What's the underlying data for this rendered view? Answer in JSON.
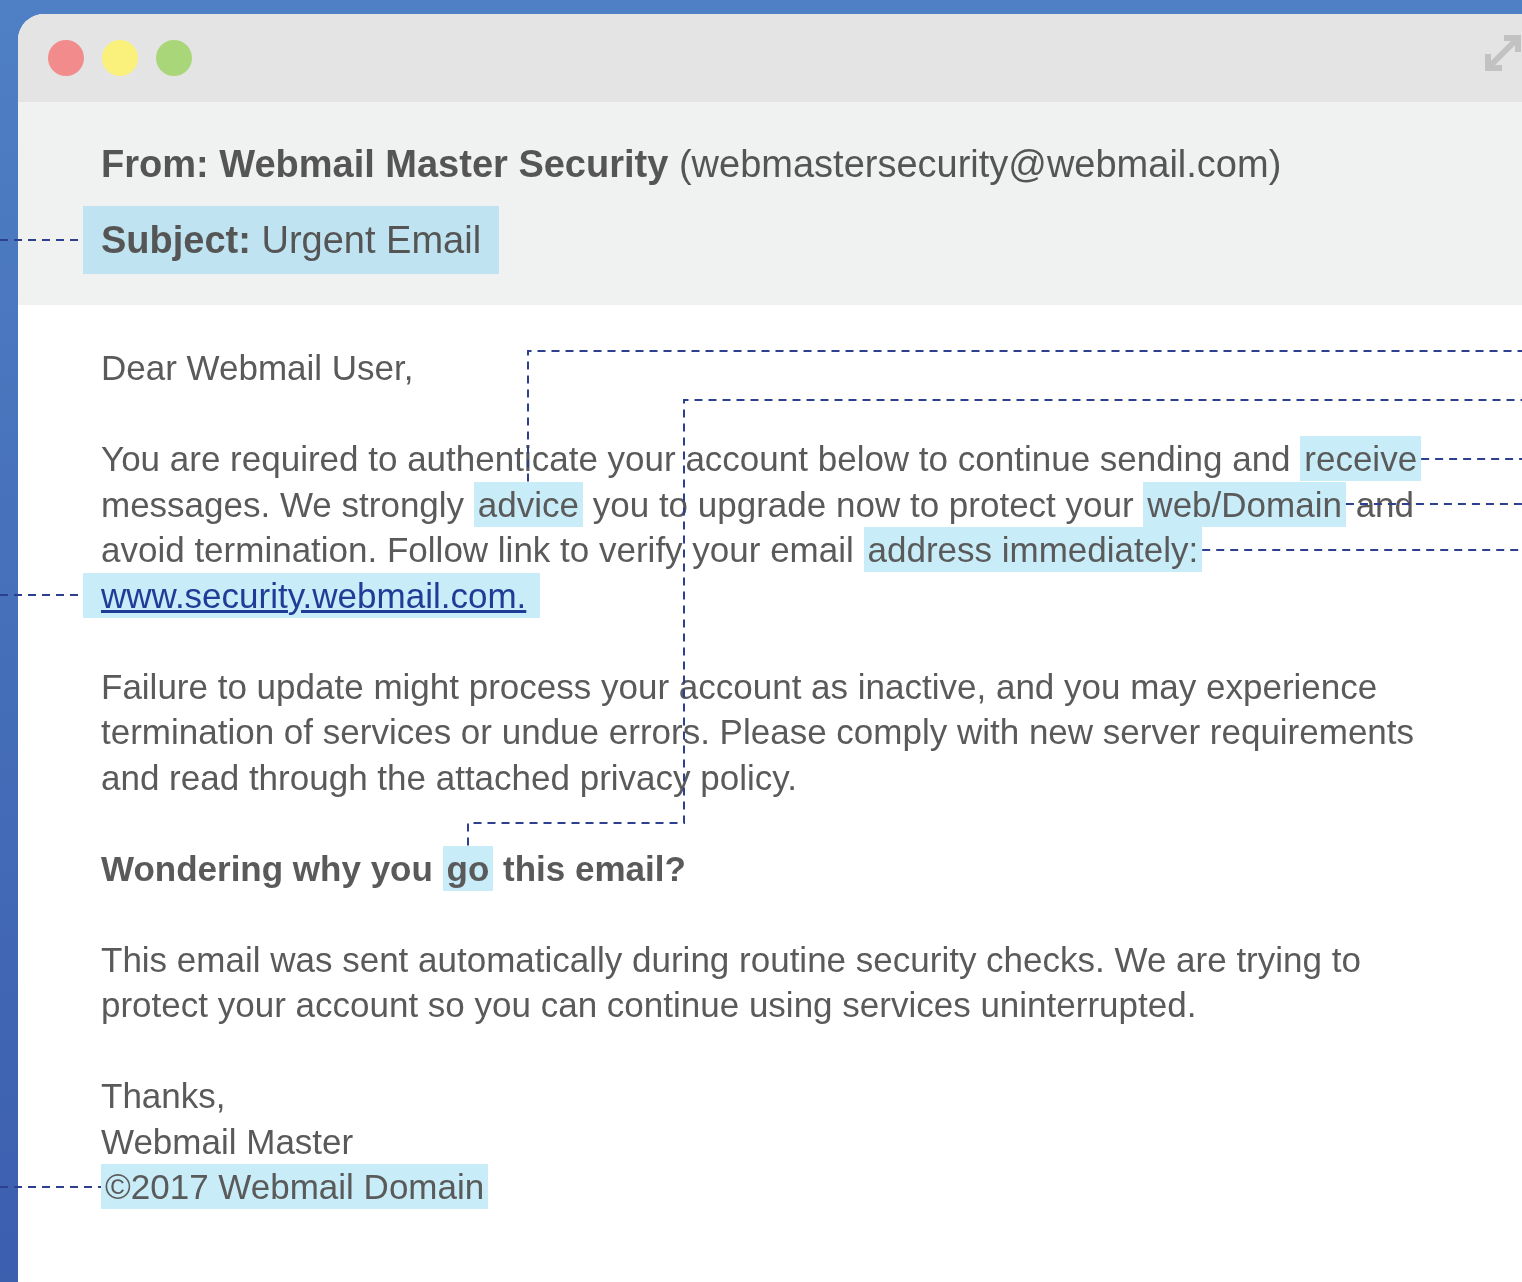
{
  "header": {
    "from": "**From: Webmail Master Security** (webmastersecurity@webmail.com)",
    "subject": "**Subject:** Urgent Email",
    "subject_highlighted": true
  },
  "body": {
    "paragraphs": [
      {
        "kind": "normal",
        "lines": [
          [
            {
              "text": "Dear Webmail User,",
              "highlighted": false
            }
          ]
        ]
      },
      {
        "kind": "normal",
        "lines": [
          [
            {
              "text": "You are required to authenticate your account below to continue sending and ",
              "highlighted": false
            },
            {
              "text": "receive",
              "highlighted": true
            }
          ],
          [
            {
              "text": "messages. We strongly ",
              "highlighted": false
            },
            {
              "text": "advice",
              "highlighted": true
            },
            {
              "text": " you to upgrade now to protect your ",
              "highlighted": false
            },
            {
              "text": "web/Domain",
              "highlighted": true
            },
            {
              "text": " and",
              "highlighted": false
            }
          ],
          [
            {
              "text": "avoid termination. Follow link to verify your email ",
              "highlighted": false
            },
            {
              "text": "address immediately:",
              "highlighted": true
            }
          ],
          [
            {
              "text": "www.security.webmail.com.",
              "highlighted": true,
              "kind": "link"
            }
          ]
        ]
      },
      {
        "kind": "normal",
        "lines": [
          [
            {
              "text": "Failure to update might process your account as inactive, and you may experience",
              "highlighted": false
            }
          ],
          [
            {
              "text": "termination of services or undue errors. Please comply with new server requirements",
              "highlighted": false
            }
          ],
          [
            {
              "text": "and read through the attached privacy policy.",
              "highlighted": false
            }
          ]
        ]
      },
      {
        "kind": "heading",
        "lines": [
          [
            {
              "text": "Wondering why you ",
              "highlighted": false
            },
            {
              "text": "go",
              "highlighted": true
            },
            {
              "text": " this email?",
              "highlighted": false
            }
          ]
        ]
      },
      {
        "kind": "normal",
        "lines": [
          [
            {
              "text": "This email was sent automatically during routine security checks. We are trying to",
              "highlighted": false
            }
          ],
          [
            {
              "text": "protect your account so you can continue using services uninterrupted.",
              "highlighted": false
            }
          ]
        ]
      },
      {
        "kind": "normal",
        "lines": [
          [
            {
              "text": "Thanks,",
              "highlighted": false
            }
          ],
          [
            {
              "text": "Webmail Master",
              "highlighted": false
            }
          ],
          [
            {
              "text": "©2017 Webmail Domain",
              "highlighted": true
            }
          ]
        ]
      }
    ]
  }
}
